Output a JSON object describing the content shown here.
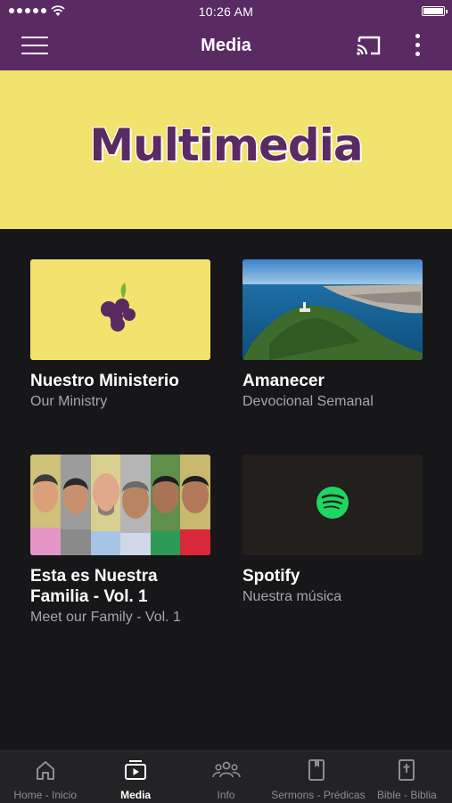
{
  "status_bar": {
    "time": "10:26 AM"
  },
  "app_bar": {
    "title": "Media"
  },
  "banner": {
    "title": "Multimedia",
    "background": "#f2e26e",
    "text_color": "#5a2a63"
  },
  "cards": [
    {
      "title": "Nuestro Ministerio",
      "subtitle": "Our Ministry",
      "thumbnail": "grapes-logo"
    },
    {
      "title": "Amanecer",
      "subtitle": "Devocional Semanal",
      "thumbnail": "coastal-city-photo"
    },
    {
      "title": "Esta es Nuestra Familia - Vol. 1",
      "subtitle": "Meet our Family - Vol. 1",
      "thumbnail": "family-portraits-photo"
    },
    {
      "title": "Spotify",
      "subtitle": "Nuestra música",
      "thumbnail": "spotify-logo"
    }
  ],
  "bottom_nav": [
    {
      "label": "Home - Inicio",
      "icon": "home-icon",
      "active": false
    },
    {
      "label": "Media",
      "icon": "media-icon",
      "active": true
    },
    {
      "label": "Info",
      "icon": "people-icon",
      "active": false
    },
    {
      "label": "Sermons - Prédicas",
      "icon": "bookmark-book-icon",
      "active": false
    },
    {
      "label": "Bible - Biblia",
      "icon": "bible-icon",
      "active": false
    }
  ],
  "colors": {
    "brand": "#5a2a63",
    "background": "#171719",
    "nav_bg": "#232325",
    "spotify_green": "#1ed760"
  }
}
